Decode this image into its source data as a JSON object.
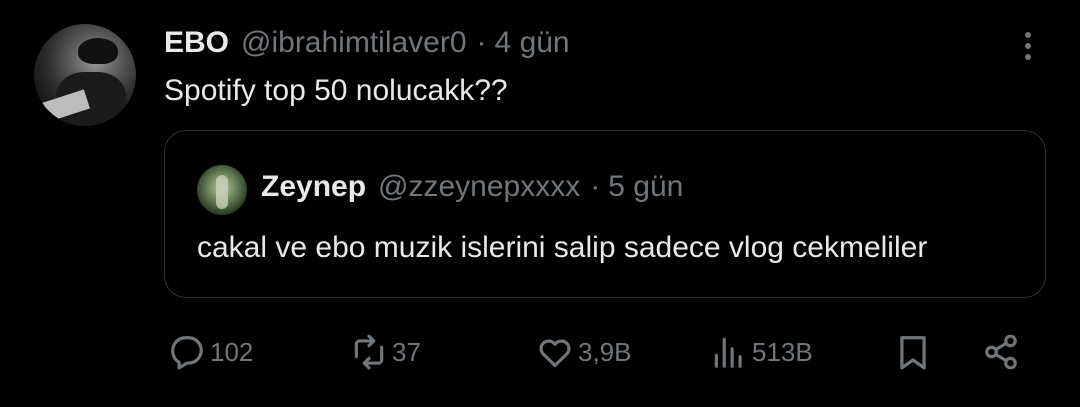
{
  "tweet": {
    "author_name": "EBO",
    "author_handle": "@ibrahimtilaver0",
    "separator": "·",
    "time": "4 gün",
    "text": "Spotify top 50 nolucakk??"
  },
  "quote": {
    "author_name": "Zeynep",
    "author_handle": "@zzeynepxxxx",
    "separator": "·",
    "time": "5 gün",
    "text": "cakal ve ebo muzik islerini salip sadece vlog cekmeliler"
  },
  "actions": {
    "replies": "102",
    "reposts": "37",
    "likes": "3,9B",
    "views": "513B"
  },
  "icons": {
    "more": "more-icon",
    "reply": "reply-icon",
    "repost": "repost-icon",
    "like": "heart-icon",
    "views": "views-icon",
    "bookmark": "bookmark-icon",
    "share": "share-icon"
  },
  "colors": {
    "background": "#000000",
    "text": "#e7e9ea",
    "muted": "#71767b",
    "border": "#2f3336"
  }
}
